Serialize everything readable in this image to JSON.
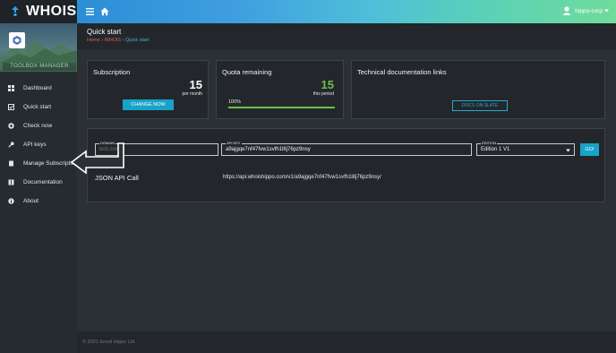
{
  "app": {
    "name": "WHOIS"
  },
  "user": {
    "name": "hippo-corp"
  },
  "profile": {
    "caption": "TOOLBOX MANAGER"
  },
  "sidebar": {
    "items": [
      {
        "label": "Dashboard",
        "icon": "grid-icon"
      },
      {
        "label": "Quick start",
        "icon": "checklist-icon"
      },
      {
        "label": "Check now",
        "icon": "circle-plus-icon"
      },
      {
        "label": "API keys",
        "icon": "key-icon"
      },
      {
        "label": "Manage Subscription",
        "icon": "document-icon"
      },
      {
        "label": "Documentation",
        "icon": "book-icon"
      },
      {
        "label": "About",
        "icon": "info-icon"
      }
    ]
  },
  "page": {
    "title": "Quick start",
    "breadcrumbs": [
      "Home",
      "WHOIS",
      "Quick start"
    ]
  },
  "subscription": {
    "title": "Subscription",
    "value": "15",
    "unit": "per month",
    "button": "CHANGE NOW"
  },
  "quota": {
    "title": "Quota remaining",
    "value": "15",
    "unit": "this period",
    "progress_label": "100%",
    "progress": 1.0
  },
  "docs": {
    "title": "Technical documentation links",
    "button": "DOCS ON SLATE"
  },
  "query": {
    "domain_label": "DOMAIN",
    "domain_placeholder": "test.com",
    "apikey_label": "API KEY",
    "apikey_value": "a9ajgqe7nf47fvw1svfh1l8j76pz9nsy",
    "edition_label": "EDITION",
    "edition_value": "Edition 1 V1",
    "go_button": "GO!",
    "json_label": "JSON API Call",
    "json_url": "https://api.whoishippo.com/v1/a9ajgqe7nf47fvw1svfh1l8j76pz9nsy/"
  },
  "footer": {
    "text": "© 2021 Email Hippo Ltd"
  },
  "colors": {
    "accent": "#17a3c9",
    "quota_value": "#6cc04a",
    "breadcrumb_link": "#e45a5a",
    "progress": "#6cc04a"
  }
}
